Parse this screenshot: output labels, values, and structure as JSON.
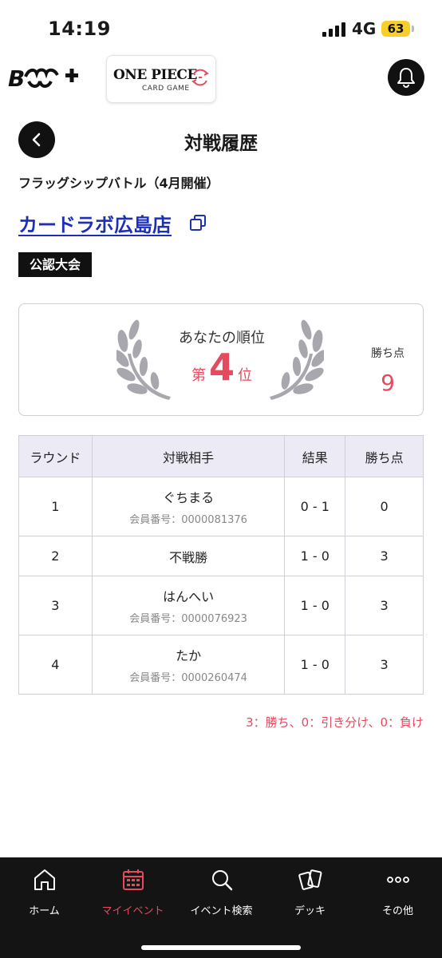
{
  "status_bar": {
    "time": "14:19",
    "network": "4G",
    "battery": "63"
  },
  "header": {
    "brand_logo": "B",
    "game_logo": {
      "title": "ONE PIECE",
      "subtitle": "CARD GAME"
    }
  },
  "page": {
    "title": "対戦履歴",
    "event_name": "フラッグシップバトル（4月開催）",
    "store_name": "カードラボ広島店",
    "category": "公認大会"
  },
  "rank_card": {
    "label": "あなたの順位",
    "rank_prefix": "第",
    "rank_number": "4",
    "rank_suffix": "位",
    "points_label": "勝ち点",
    "points_value": "9"
  },
  "table": {
    "headers": [
      "ラウンド",
      "対戦相手",
      "結果",
      "勝ち点"
    ],
    "rows": [
      {
        "round": "1",
        "opponent": "ぐちまる",
        "member_no": "会員番号：0000081376",
        "result": "0 - 1",
        "points": "0"
      },
      {
        "round": "2",
        "opponent": "不戦勝",
        "member_no": "",
        "result": "1 - 0",
        "points": "3"
      },
      {
        "round": "3",
        "opponent": "はんへい",
        "member_no": "会員番号：0000076923",
        "result": "1 - 0",
        "points": "3"
      },
      {
        "round": "4",
        "opponent": "たか",
        "member_no": "会員番号：0000260474",
        "result": "1 - 0",
        "points": "3"
      }
    ]
  },
  "legend": "3：勝ち、0：引き分け、0：負け",
  "tabs": [
    {
      "label": "ホーム",
      "icon": "home-icon",
      "active": false
    },
    {
      "label": "マイイベント",
      "icon": "calendar-icon",
      "active": true
    },
    {
      "label": "イベント検索",
      "icon": "search-icon",
      "active": false
    },
    {
      "label": "デッキ",
      "icon": "cards-icon",
      "active": false
    },
    {
      "label": "その他",
      "icon": "more-icon",
      "active": false
    }
  ],
  "colors": {
    "accent": "#e64a5e",
    "link": "#1d2fb8",
    "dark": "#141414",
    "table_header": "#ecebf5"
  }
}
